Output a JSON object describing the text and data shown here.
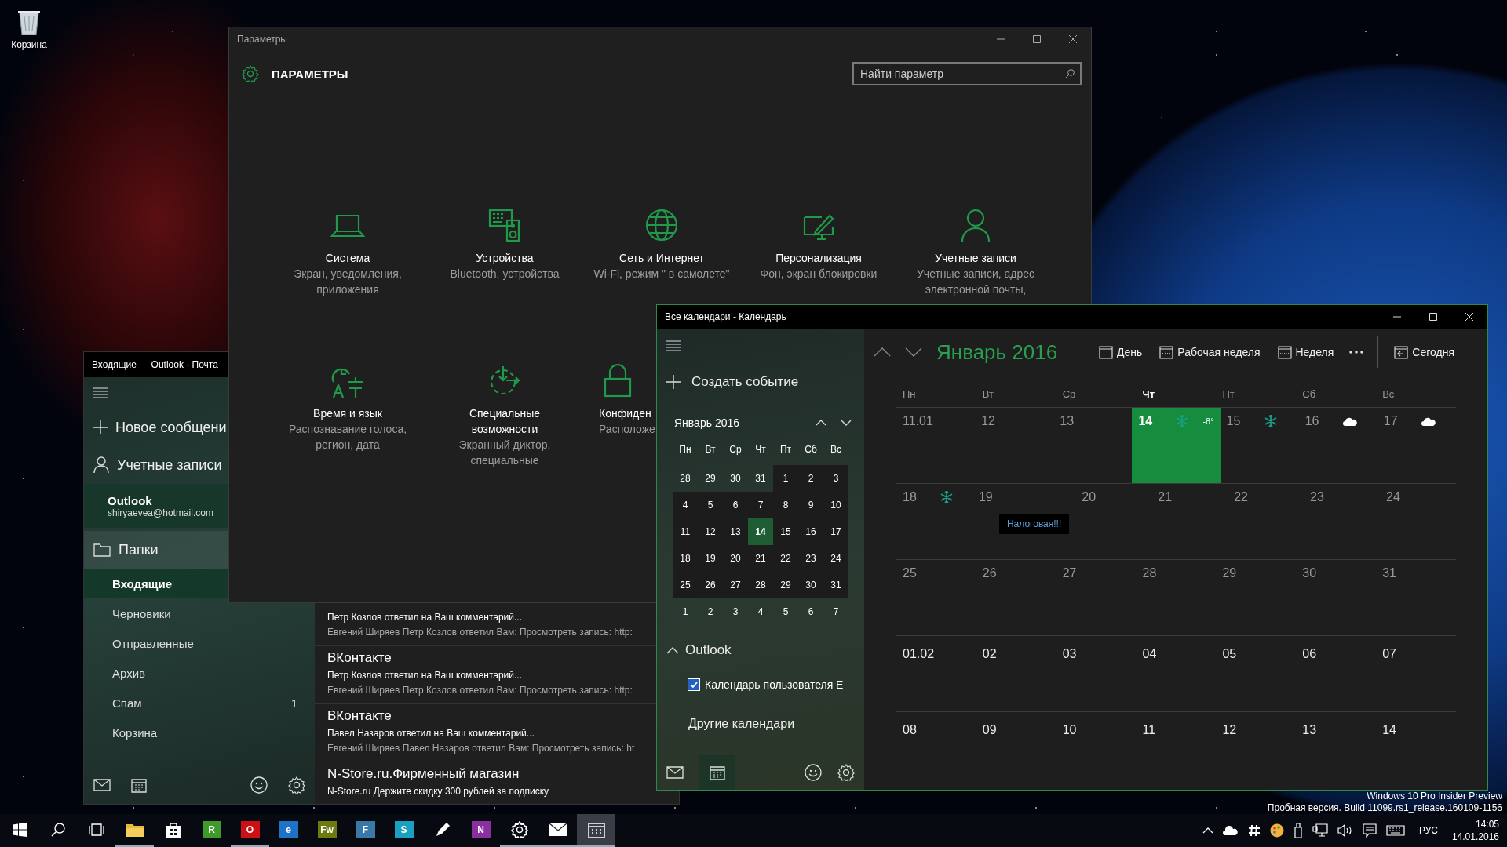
{
  "desktop": {
    "icons": [
      {
        "label": "Корзина"
      }
    ],
    "watermark": [
      "Windows 10 Pro Insider Preview",
      "Пробная версия. Build 11099.rs1_release.160109-1156"
    ]
  },
  "mail": {
    "title": "Входящие — Outlook - Почта",
    "new_message": "Новое сообщени",
    "accounts": "Учетные записи",
    "account": {
      "name": "Outlook",
      "email": "shiryaevea@hotmail.com"
    },
    "folders_label": "Папки",
    "folders": [
      {
        "name": "Входящие",
        "selected": true
      },
      {
        "name": "Черновики",
        "selected": false
      },
      {
        "name": "Отправленные",
        "selected": false
      },
      {
        "name": "Архив",
        "selected": false
      },
      {
        "name": "Спам",
        "selected": false,
        "count": "1"
      },
      {
        "name": "Корзина",
        "selected": false
      }
    ],
    "messages": [
      {
        "subject": "Петр Козлов ответил на Ваш комментарий...",
        "preview": "Евгений Ширяев Петр Козлов ответил Вам: Просмотреть запись: http:"
      },
      {
        "sender": "ВКонтакте",
        "subject": "Петр Козлов ответил на Ваш комментарий...",
        "preview": "Евгений Ширяев Петр Козлов ответил Вам: Просмотреть запись: http:"
      },
      {
        "sender": "ВКонтакте",
        "subject": "Павел Назаров ответил на Ваш комментарий...",
        "preview": "Евгений Ширяев Павел Назаров ответил Вам: Просмотреть запись: ht"
      },
      {
        "sender": "N-Store.ru.Фирменный магазин",
        "subject": "N-Store.ru Держите скидку 300 рублей за подписку"
      }
    ]
  },
  "settings": {
    "title": "Параметры",
    "heading": "ПАРАМЕТРЫ",
    "search": {
      "placeholder": "Найти параметр"
    },
    "categories": [
      {
        "kind": "laptop",
        "title": "Система",
        "description": "Экран, уведомления, приложения",
        "partly_hidden": false
      },
      {
        "kind": "devices",
        "title": "Устройства",
        "description": "Bluetooth, устройства",
        "partly_hidden": false
      },
      {
        "kind": "globe",
        "title": "Сеть и Интернет",
        "description": "Wi-Fi, режим \" в самолете\"",
        "partly_hidden": false
      },
      {
        "kind": "personalize",
        "title": "Персонализация",
        "description": "Фон, экран блокировки",
        "partly_hidden": false
      },
      {
        "kind": "person",
        "title": "Учетные записи",
        "description": "Учетные записи, адрес электронной почты,",
        "partly_hidden": false
      },
      {
        "kind": "time",
        "title": "Время и язык",
        "description": "Распознавание голоса, регион, дата",
        "partly_hidden": false
      },
      {
        "kind": "accessibility",
        "title": "Специальные возможности",
        "description": "Экранный диктор, специальные",
        "partly_hidden": false
      },
      {
        "kind": "lock",
        "title": "Конфиден",
        "description": "Расположе",
        "partly_hidden": true
      }
    ]
  },
  "calendar": {
    "title": "Все календари - Календарь",
    "new_event": "Создать событие",
    "mini_month": {
      "title": "Январь 2016",
      "weekdays": [
        "Пн",
        "Вт",
        "Ср",
        "Чт",
        "Пт",
        "Сб",
        "Вс"
      ],
      "weeks": [
        [
          {
            "day": "28",
            "in_month": false,
            "today": false
          },
          {
            "day": "29",
            "in_month": false,
            "today": false
          },
          {
            "day": "30",
            "in_month": false,
            "today": false
          },
          {
            "day": "31",
            "in_month": false,
            "today": false
          },
          {
            "day": "1",
            "in_month": true,
            "today": false
          },
          {
            "day": "2",
            "in_month": true,
            "today": false
          },
          {
            "day": "3",
            "in_month": true,
            "today": false
          }
        ],
        [
          {
            "day": "4",
            "in_month": true,
            "today": false
          },
          {
            "day": "5",
            "in_month": true,
            "today": false
          },
          {
            "day": "6",
            "in_month": true,
            "today": false
          },
          {
            "day": "7",
            "in_month": true,
            "today": false
          },
          {
            "day": "8",
            "in_month": true,
            "today": false
          },
          {
            "day": "9",
            "in_month": true,
            "today": false
          },
          {
            "day": "10",
            "in_month": true,
            "today": false
          }
        ],
        [
          {
            "day": "11",
            "in_month": true,
            "today": false
          },
          {
            "day": "12",
            "in_month": true,
            "today": false
          },
          {
            "day": "13",
            "in_month": true,
            "today": false
          },
          {
            "day": "14",
            "in_month": true,
            "today": true
          },
          {
            "day": "15",
            "in_month": true,
            "today": false
          },
          {
            "day": "16",
            "in_month": true,
            "today": false
          },
          {
            "day": "17",
            "in_month": true,
            "today": false
          }
        ],
        [
          {
            "day": "18",
            "in_month": true,
            "today": false
          },
          {
            "day": "19",
            "in_month": true,
            "today": false
          },
          {
            "day": "20",
            "in_month": true,
            "today": false
          },
          {
            "day": "21",
            "in_month": true,
            "today": false
          },
          {
            "day": "22",
            "in_month": true,
            "today": false
          },
          {
            "day": "23",
            "in_month": true,
            "today": false
          },
          {
            "day": "24",
            "in_month": true,
            "today": false
          }
        ],
        [
          {
            "day": "25",
            "in_month": true,
            "today": false
          },
          {
            "day": "26",
            "in_month": true,
            "today": false
          },
          {
            "day": "27",
            "in_month": true,
            "today": false
          },
          {
            "day": "28",
            "in_month": true,
            "today": false
          },
          {
            "day": "29",
            "in_month": true,
            "today": false
          },
          {
            "day": "30",
            "in_month": true,
            "today": false
          },
          {
            "day": "31",
            "in_month": true,
            "today": false
          }
        ],
        [
          {
            "day": "1",
            "in_month": false,
            "today": false
          },
          {
            "day": "2",
            "in_month": false,
            "today": false
          },
          {
            "day": "3",
            "in_month": false,
            "today": false
          },
          {
            "day": "4",
            "in_month": false,
            "today": false
          },
          {
            "day": "5",
            "in_month": false,
            "today": false
          },
          {
            "day": "6",
            "in_month": false,
            "today": false
          },
          {
            "day": "7",
            "in_month": false,
            "today": false
          }
        ]
      ]
    },
    "group": {
      "name": "Outlook",
      "expanded": true
    },
    "calendars": [
      {
        "name": "Календарь пользователя Е",
        "checked": true
      }
    ],
    "other_calendars": "Другие календари",
    "month_title": "Январь 2016",
    "views": [
      {
        "kind": "day",
        "label": "День"
      },
      {
        "kind": "workweek",
        "label": "Рабочая неделя"
      },
      {
        "kind": "week",
        "label": "Неделя"
      }
    ],
    "today_button": "Сегодня",
    "weekdays": [
      {
        "label": "Пн",
        "today": false
      },
      {
        "label": "Вт",
        "today": false
      },
      {
        "label": "Ср",
        "today": false
      },
      {
        "label": "Чт",
        "today": true
      },
      {
        "label": "Пт",
        "today": false
      },
      {
        "label": "Сб",
        "today": false
      },
      {
        "label": "Вс",
        "today": false
      }
    ],
    "weeks": [
      [
        {
          "label": "11.01",
          "other_month": false,
          "today": false
        },
        {
          "label": "12",
          "other_month": false,
          "today": false
        },
        {
          "label": "13",
          "other_month": false,
          "today": false
        },
        {
          "label": "14",
          "other_month": false,
          "today": true,
          "weather": {
            "kind": "snow"
          },
          "temperature": "-8°"
        },
        {
          "label": "15",
          "other_month": false,
          "today": false,
          "weather": {
            "kind": "snow"
          }
        },
        {
          "label": "16",
          "other_month": false,
          "today": false,
          "weather": {
            "kind": "cloud"
          }
        },
        {
          "label": "17",
          "other_month": false,
          "today": false,
          "weather": {
            "kind": "cloud"
          }
        }
      ],
      [
        {
          "label": "18",
          "other_month": false,
          "today": false,
          "weather": {
            "kind": "snow"
          }
        },
        {
          "label": "19",
          "other_month": false,
          "today": false,
          "events": [
            "Налоговая!!!"
          ]
        },
        {
          "label": "20",
          "other_month": false,
          "today": false
        },
        {
          "label": "21",
          "other_month": false,
          "today": false
        },
        {
          "label": "22",
          "other_month": false,
          "today": false
        },
        {
          "label": "23",
          "other_month": false,
          "today": false
        },
        {
          "label": "24",
          "other_month": false,
          "today": false
        }
      ],
      [
        {
          "label": "25",
          "other_month": false,
          "today": false
        },
        {
          "label": "26",
          "other_month": false,
          "today": false
        },
        {
          "label": "27",
          "other_month": false,
          "today": false
        },
        {
          "label": "28",
          "other_month": false,
          "today": false
        },
        {
          "label": "29",
          "other_month": false,
          "today": false
        },
        {
          "label": "30",
          "other_month": false,
          "today": false
        },
        {
          "label": "31",
          "other_month": false,
          "today": false
        }
      ],
      [
        {
          "label": "01.02",
          "other_month": true,
          "today": false
        },
        {
          "label": "02",
          "other_month": true,
          "today": false
        },
        {
          "label": "03",
          "other_month": true,
          "today": false
        },
        {
          "label": "04",
          "other_month": true,
          "today": false
        },
        {
          "label": "05",
          "other_month": true,
          "today": false
        },
        {
          "label": "06",
          "other_month": true,
          "today": false
        },
        {
          "label": "07",
          "other_month": true,
          "today": false
        }
      ],
      [
        {
          "label": "08",
          "other_month": true,
          "today": false
        },
        {
          "label": "09",
          "other_month": true,
          "today": false
        },
        {
          "label": "10",
          "other_month": true,
          "today": false
        },
        {
          "label": "11",
          "other_month": true,
          "today": false
        },
        {
          "label": "12",
          "other_month": true,
          "today": false
        },
        {
          "label": "13",
          "other_month": true,
          "today": false
        },
        {
          "label": "14",
          "other_month": true,
          "today": false
        }
      ]
    ]
  },
  "taskbar": {
    "apps": [
      {
        "kind": "folder",
        "running": true,
        "selected": false
      },
      {
        "kind": "bag",
        "running": false,
        "selected": false
      },
      {
        "kind": "tile",
        "color": "#3f9a2c",
        "glyph": "R",
        "running": false,
        "selected": false
      },
      {
        "kind": "tile",
        "color": "#cc1016",
        "glyph": "O",
        "running": true,
        "selected": false
      },
      {
        "kind": "tile",
        "color": "#1e72c8",
        "glyph": "e",
        "running": false,
        "selected": false
      },
      {
        "kind": "tile",
        "color": "#6c7a10",
        "glyph": "Fw",
        "running": false,
        "selected": false
      },
      {
        "kind": "tile",
        "color": "#3a78a8",
        "glyph": "F",
        "running": false,
        "selected": false
      },
      {
        "kind": "tile",
        "color": "#1aa0c0",
        "glyph": "S",
        "running": false,
        "selected": false
      },
      {
        "kind": "pen",
        "running": false,
        "selected": false
      },
      {
        "kind": "tile",
        "color": "#8a2fa0",
        "glyph": "N",
        "running": false,
        "selected": false
      },
      {
        "kind": "gear",
        "running": true,
        "selected": false
      },
      {
        "kind": "mail",
        "running": true,
        "selected": false
      },
      {
        "kind": "calendar",
        "running": true,
        "selected": true
      }
    ],
    "language": "РУС",
    "time": "14:05",
    "date": "14.01.2016"
  }
}
